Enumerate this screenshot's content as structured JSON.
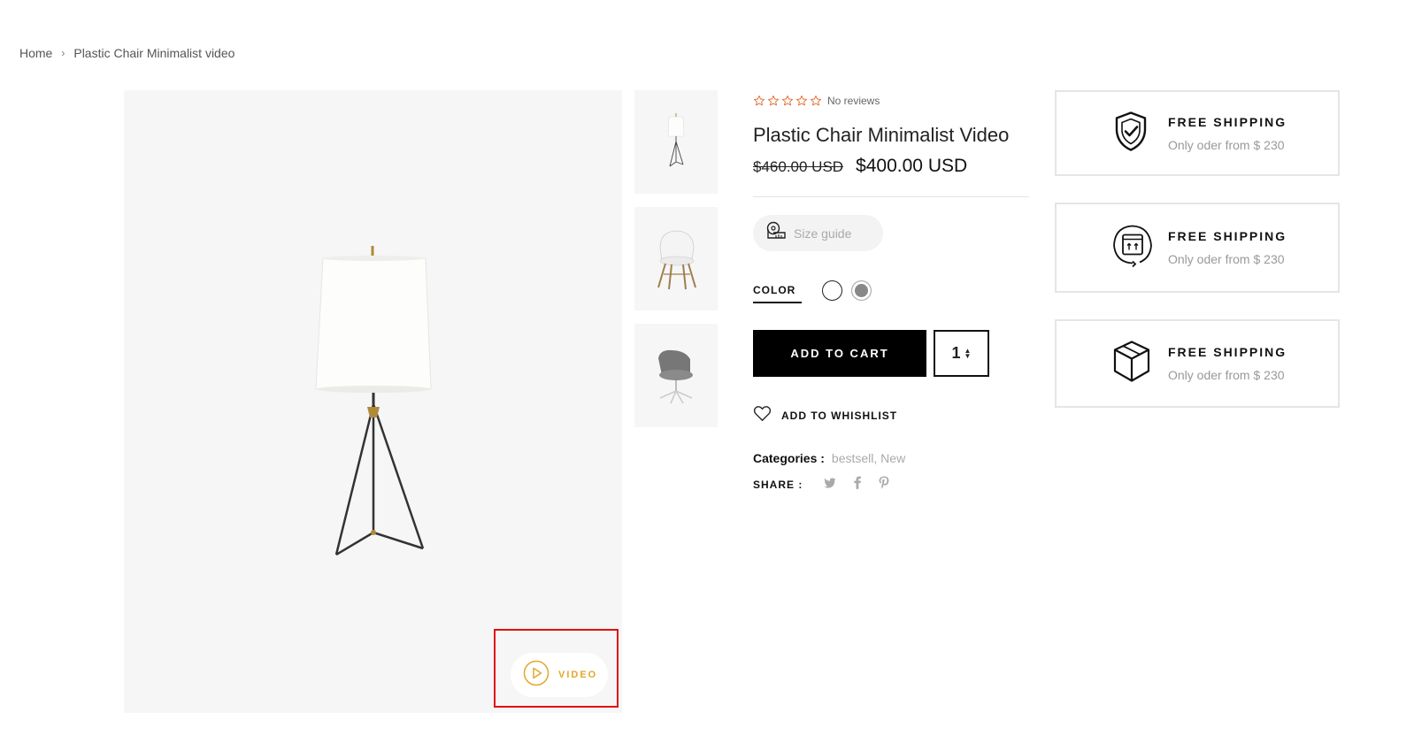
{
  "breadcrumb": {
    "home": "Home",
    "separator": "›",
    "current": "Plastic Chair Minimalist video"
  },
  "gallery": {
    "video_label": "VIDEO",
    "video_icon": "play-circle-icon",
    "accent_color": "#e3a72b",
    "thumbnails": [
      "floor-lamp",
      "white-chair",
      "grey-swivel-chair"
    ]
  },
  "product": {
    "rating_stars": 5,
    "reviews_text": "No reviews",
    "title": "Plastic Chair Minimalist Video",
    "old_price": "$460.00 USD",
    "new_price": "$400.00 USD",
    "size_guide_label": "Size guide",
    "color_label": "COLOR",
    "colors": [
      "white",
      "grey"
    ],
    "add_to_cart_label": "ADD TO CART",
    "quantity": "1",
    "wishlist_label": "ADD TO WHISHLIST",
    "categories_label": "Categories :",
    "categories_values": "bestsell, New",
    "share_label": "SHARE :",
    "share_icons": [
      "twitter-icon",
      "facebook-icon",
      "pinterest-icon"
    ]
  },
  "policies": [
    {
      "icon": "shield-check-icon",
      "title": "FREE SHIPPING",
      "subtitle": "Only oder from $ 230"
    },
    {
      "icon": "box-return-icon",
      "title": "FREE SHIPPING",
      "subtitle": "Only oder from $ 230"
    },
    {
      "icon": "package-icon",
      "title": "FREE SHIPPING",
      "subtitle": "Only oder from $ 230"
    }
  ]
}
